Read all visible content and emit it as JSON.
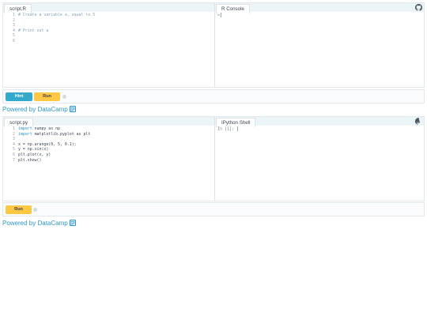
{
  "widget_r": {
    "editor_tab": "script.R",
    "console_tab": "R Console",
    "lines": [
      {
        "n": "1",
        "text": "# Create a variable a, equal to 5"
      },
      {
        "n": "2",
        "text": ""
      },
      {
        "n": "3",
        "text": ""
      },
      {
        "n": "4",
        "text": "# Print out a"
      },
      {
        "n": "5",
        "text": ""
      },
      {
        "n": "6",
        "text": ""
      }
    ],
    "console_prompt": ">",
    "hint_label": "Hint",
    "run_label": "Run",
    "powered_by": "Powered by DataCamp"
  },
  "widget_py": {
    "editor_tab": "script.py",
    "console_tab": "IPython Shell",
    "lines": [
      {
        "n": "1",
        "kw": "import",
        "text": " numpy as np"
      },
      {
        "n": "2",
        "kw": "import",
        "text": " matplotlib.pyplot as plt"
      },
      {
        "n": "3",
        "kw": "",
        "text": ""
      },
      {
        "n": "4",
        "kw": "",
        "text": "x = np.arange(0, 5, 0.1);"
      },
      {
        "n": "5",
        "kw": "",
        "text": "y = np.sin(x)"
      },
      {
        "n": "6",
        "kw": "",
        "text": "plt.plot(x, y)"
      },
      {
        "n": "7",
        "kw": "",
        "text": "plt.show()"
      }
    ],
    "console_prompt": "In [1]:",
    "run_label": "Run",
    "powered_by": "Powered by DataCamp"
  },
  "icons": {
    "github": "github-icon",
    "datacamp": "datacamp-logo-icon"
  },
  "colors": {
    "hint": "#33aacc",
    "run": "#ffc844",
    "link": "#2f98c8",
    "tabbar": "#ebf4f7"
  }
}
